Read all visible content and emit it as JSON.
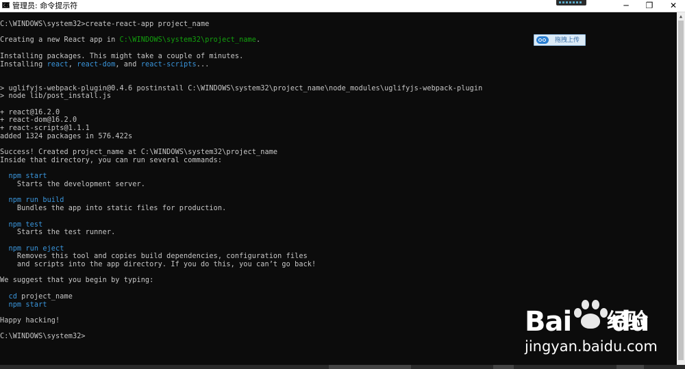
{
  "window": {
    "title": "管理员: 命令提示符",
    "icon_label": "C:\\",
    "buttons": {
      "minimize": "─",
      "maximize": "❐",
      "close": "✕"
    }
  },
  "console": {
    "lines": [
      [
        {
          "t": "C:\\WINDOWS\\system32>create-react-app project_name"
        }
      ],
      [],
      [
        {
          "t": "Creating a new React app in "
        },
        {
          "t": "C:\\WINDOWS\\system32\\project_name",
          "k": "g"
        },
        {
          "t": "."
        }
      ],
      [],
      [
        {
          "t": "Installing packages. This might take a couple of minutes."
        }
      ],
      [
        {
          "t": "Installing "
        },
        {
          "t": "react",
          "k": "c"
        },
        {
          "t": ", "
        },
        {
          "t": "react-dom",
          "k": "c"
        },
        {
          "t": ", and "
        },
        {
          "t": "react-scripts",
          "k": "c"
        },
        {
          "t": "..."
        }
      ],
      [],
      [],
      [
        {
          "t": "> uglifyjs-webpack-plugin@0.4.6 postinstall C:\\WINDOWS\\system32\\project_name\\node_modules\\uglifyjs-webpack-plugin"
        }
      ],
      [
        {
          "t": "> node lib/post_install.js"
        }
      ],
      [],
      [
        {
          "t": "+ react@16.2.0"
        }
      ],
      [
        {
          "t": "+ react-dom@16.2.0"
        }
      ],
      [
        {
          "t": "+ react-scripts@1.1.1"
        }
      ],
      [
        {
          "t": "added 1324 packages in 576.422s"
        }
      ],
      [],
      [
        {
          "t": "Success! Created project_name at C:\\WINDOWS\\system32\\project_name"
        }
      ],
      [
        {
          "t": "Inside that directory, you can run several commands:"
        }
      ],
      [],
      [
        {
          "t": "  "
        },
        {
          "t": "npm start",
          "k": "c"
        }
      ],
      [
        {
          "t": "    Starts the development server."
        }
      ],
      [],
      [
        {
          "t": "  "
        },
        {
          "t": "npm run build",
          "k": "c"
        }
      ],
      [
        {
          "t": "    Bundles the app into static files for production."
        }
      ],
      [],
      [
        {
          "t": "  "
        },
        {
          "t": "npm test",
          "k": "c"
        }
      ],
      [
        {
          "t": "    Starts the test runner."
        }
      ],
      [],
      [
        {
          "t": "  "
        },
        {
          "t": "npm run eject",
          "k": "c"
        }
      ],
      [
        {
          "t": "    Removes this tool and copies build dependencies, configuration files"
        }
      ],
      [
        {
          "t": "    and scripts into the app directory. If you do this, you can’t go back!"
        }
      ],
      [],
      [
        {
          "t": "We suggest that you begin by typing:"
        }
      ],
      [],
      [
        {
          "t": "  "
        },
        {
          "t": "cd",
          "k": "c"
        },
        {
          "t": " project_name"
        }
      ],
      [
        {
          "t": "  "
        },
        {
          "t": "npm start",
          "k": "c"
        }
      ],
      [],
      [
        {
          "t": "Happy hacking!"
        }
      ],
      [],
      [
        {
          "t": "C:\\WINDOWS\\system32>"
        }
      ]
    ]
  },
  "upload_button": {
    "label": "拖拽上传",
    "icon": "baidu-cloud-icon"
  },
  "watermark": {
    "brand_bai": "Bai",
    "brand_du": "du",
    "brand_jy": "经验",
    "url": "jingyan.baidu.com",
    "icon": "baidu-paw-icon"
  },
  "colors": {
    "background": "#0c0c0c",
    "text": "#c8c8c8",
    "path_green": "#13a10e",
    "command_cyan": "#3a96dd"
  }
}
